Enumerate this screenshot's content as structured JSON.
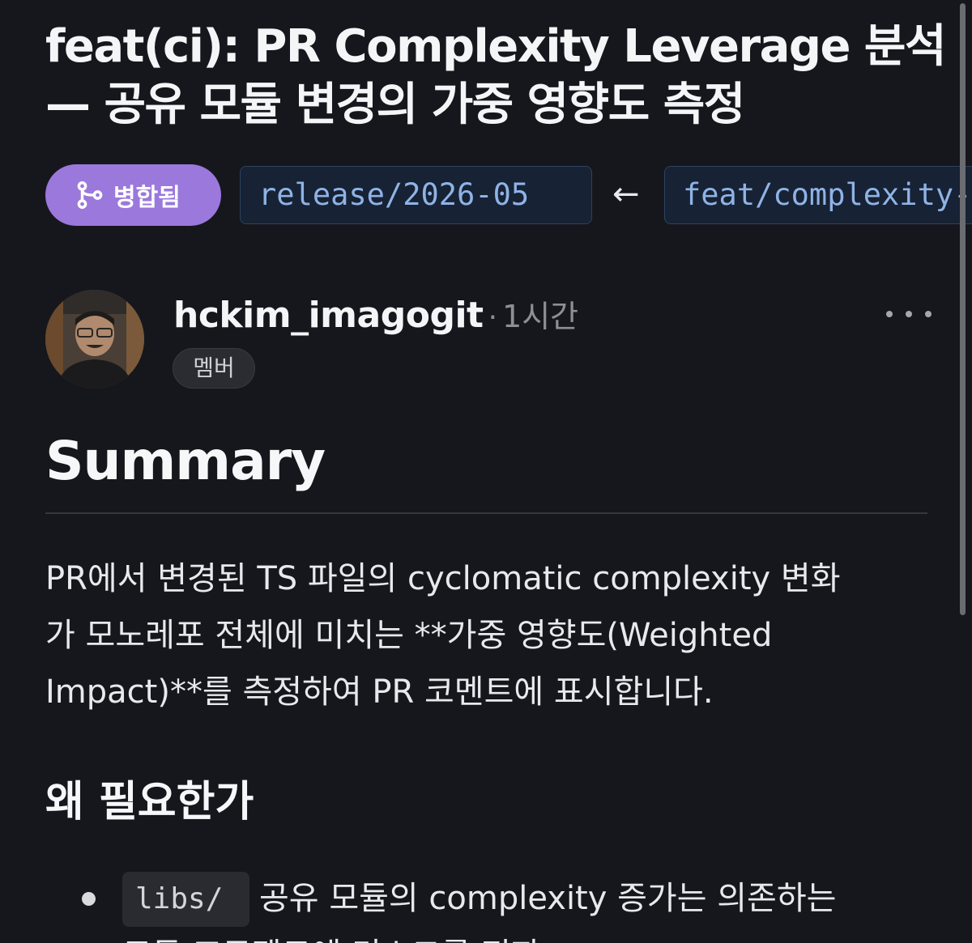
{
  "pr": {
    "title_line1": "feat(ci): PR Complexity Leverage 분석",
    "title_line2": "— 공유 모듈 변경의 가중 영향도 측정",
    "state": "병합됨",
    "base_branch": "release/2026-05",
    "arrow": "←",
    "head_branch": "feat/complexity-leverage"
  },
  "author": {
    "name": "hckim_imagogit",
    "separator": "·",
    "time": "1시간",
    "role": "멤버"
  },
  "body": {
    "summary_heading": "Summary",
    "summary_line1": "PR에서 변경된 TS 파일의 cyclomatic complexity 변화",
    "summary_line2": "가 모노레포 전체에 미치는 **가중 영향도(Weighted",
    "summary_line3": "Impact)**를 측정하여 PR 코멘트에 표시합니다.",
    "why_heading": "왜 필요한가",
    "bullet1_code": "libs/",
    "bullet1_text": "공유 모듈의 complexity 증가는 의존하는",
    "bullet1_text2": "모든 프로젝트에 리스크를 전파"
  },
  "colors": {
    "background": "#16171c",
    "merged_badge": "#9b78dc",
    "branch_text": "#8fb3e6",
    "branch_bg": "#172234"
  },
  "icons": {
    "merged": "git-merge-icon",
    "more": "more-horizontal-icon"
  }
}
